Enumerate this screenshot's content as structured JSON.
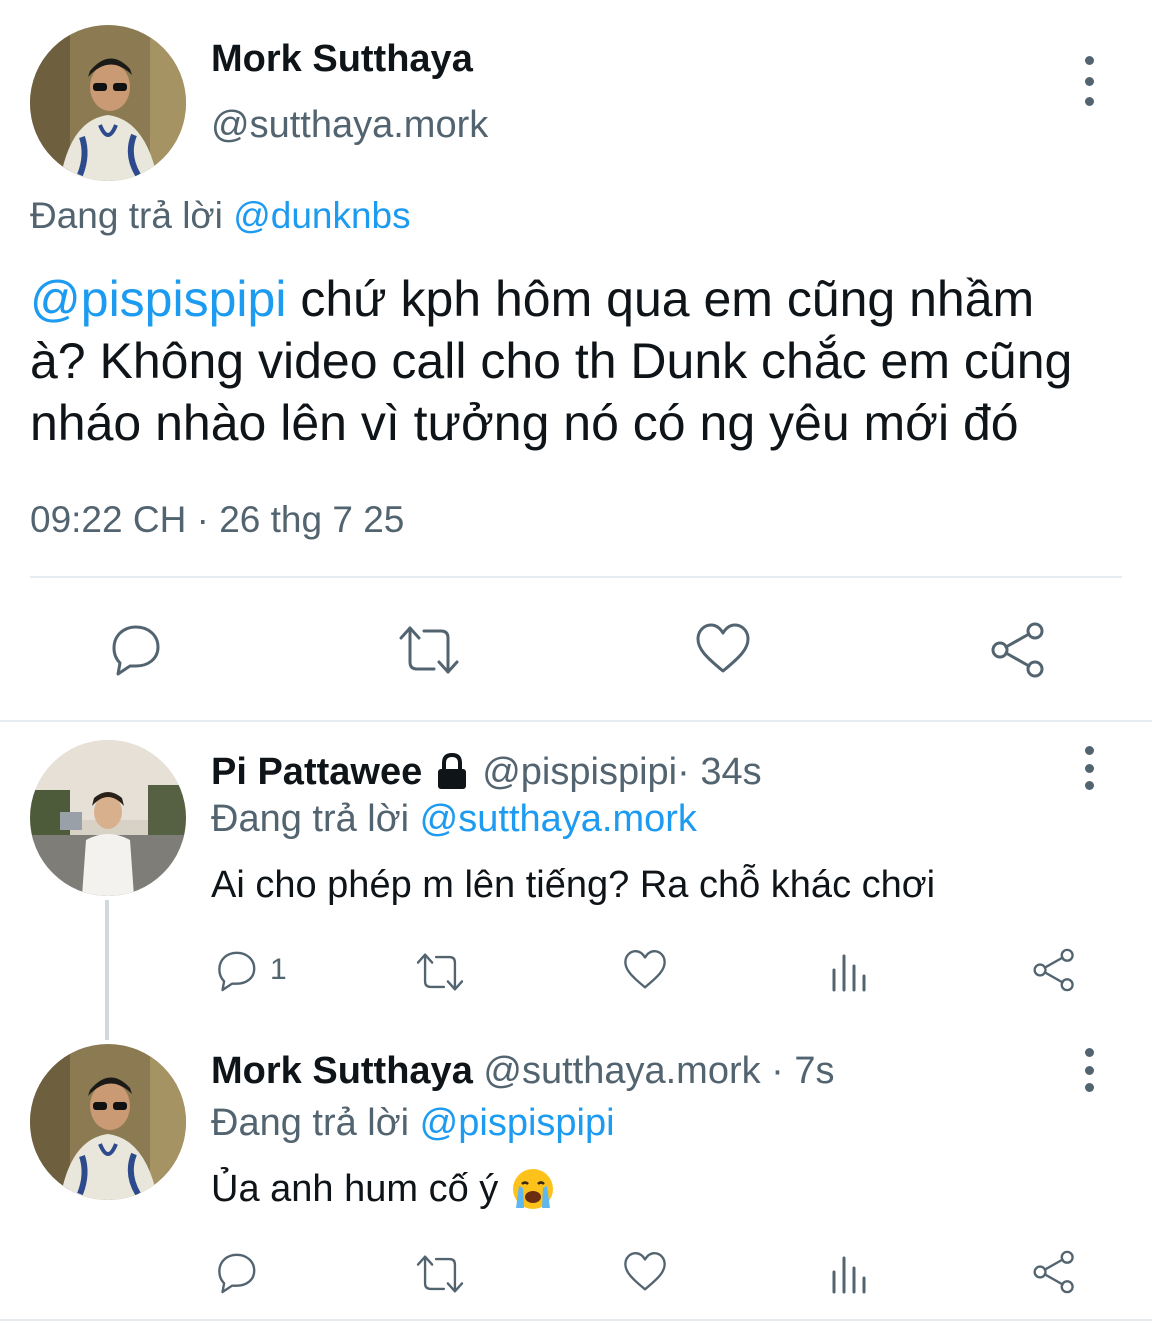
{
  "main_tweet": {
    "author_name": "Mork Sutthaya",
    "author_handle": "@sutthaya.mork",
    "reply_prefix": "Đang trả lời",
    "reply_to": "@dunknbs",
    "mention": "@pispispipi",
    "text_line1": " chứ kph hôm qua em cũng nhầm",
    "text_line2": "à? Không video call cho th Dunk chắc em cũng",
    "text_line3": "nháo nhào lên vì tưởng nó có ng yêu mới đó",
    "timestamp": "09:22 CH · 26 thg 7 25"
  },
  "replies": [
    {
      "author_name": "Pi Pattawee",
      "author_handle": "@pispispipi",
      "age": " · 34s",
      "reply_prefix": "Đang trả lời",
      "reply_to": "@sutthaya.mork",
      "text": "Ai cho phép m lên tiếng? Ra chỗ khác chơi",
      "reply_count": "1",
      "locked": true
    },
    {
      "author_name": "Mork Sutthaya",
      "author_handle": "@sutthaya.mork",
      "age": " · 7s",
      "reply_prefix": "Đang trả lời",
      "reply_to": "@pispispipi",
      "text": "Ủa anh hum cố ý",
      "emoji": "😭",
      "reply_count": ""
    }
  ],
  "icons": [
    "reply-icon",
    "retweet-icon",
    "like-icon",
    "share-icon",
    "views-icon",
    "more-icon",
    "lock-icon"
  ],
  "colors": {
    "accent": "#1d9bf0",
    "secondary_text": "#536471",
    "divider": "#e6ecf0"
  }
}
